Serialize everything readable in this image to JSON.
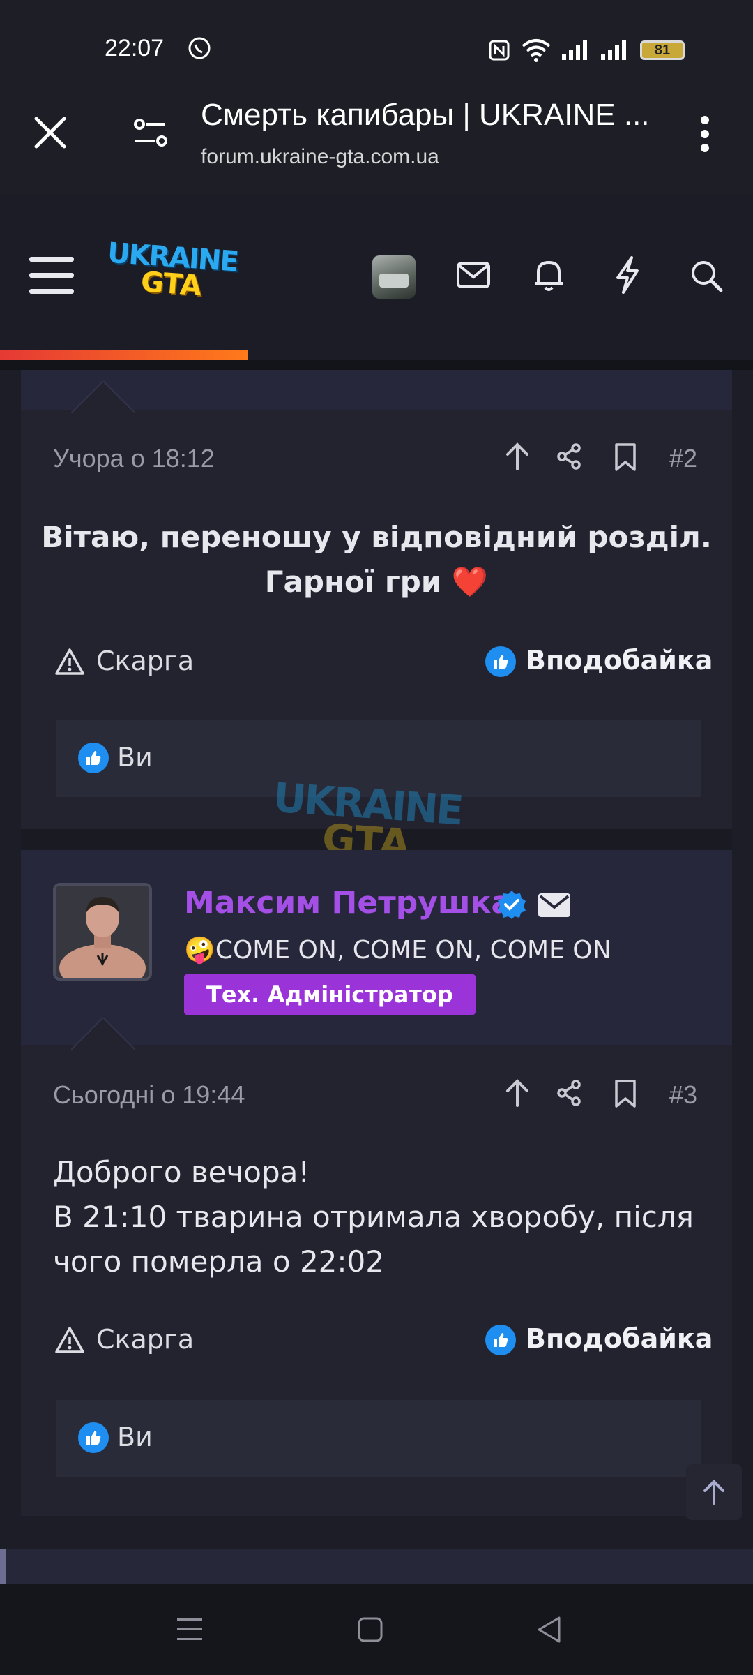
{
  "status_bar": {
    "time": "22:07",
    "battery": "81"
  },
  "browser": {
    "title": "Смерть капибары | UKRAINE ...",
    "url": "forum.ukraine-gta.com.ua"
  },
  "forum_header": {
    "logo_text_top": "UKRAINE",
    "logo_text_bottom": "GTA",
    "scroll_progress_percent": 33
  },
  "posts": [
    {
      "time": "Учора о 18:12",
      "number": "#2",
      "body": "Вітаю, переношу у відповідний розділ.\nГарної гри ❤️",
      "report_label": "Скарга",
      "like_label": "Вподобайка",
      "reactions": "Ви"
    },
    {
      "author": {
        "name": "Максим Петрушка",
        "title": "🤪COME ON, COME ON, COME ON",
        "badge": "Тех. Адміністратор"
      },
      "time": "Сьогодні о 19:44",
      "number": "#3",
      "body_lines": [
        "Доброго вечора!",
        "В 21:10 тварина отримала хворобу, після",
        "чого померла о 22:02"
      ],
      "report_label": "Скарга",
      "like_label": "Вподобайка",
      "reactions": "Ви"
    }
  ],
  "watermark": {
    "top": "UKRAINE",
    "bottom": "GTA"
  },
  "colors": {
    "accent_purple": "#a44fe6",
    "badge_purple": "#9a33d8",
    "like_blue": "#1f8ef1",
    "progress_red": "#e53935",
    "progress_orange": "#ff7a1a"
  },
  "icons": [
    "close-icon",
    "site-settings-icon",
    "more-vert-icon",
    "menu-icon",
    "mail-icon",
    "bell-icon",
    "bolt-icon",
    "search-icon",
    "arrow-up-icon",
    "share-icon",
    "bookmark-icon",
    "warning-icon",
    "thumbs-up-icon",
    "verified-icon",
    "envelope-icon",
    "nav-menu-icon",
    "nav-home-icon",
    "nav-back-icon"
  ]
}
